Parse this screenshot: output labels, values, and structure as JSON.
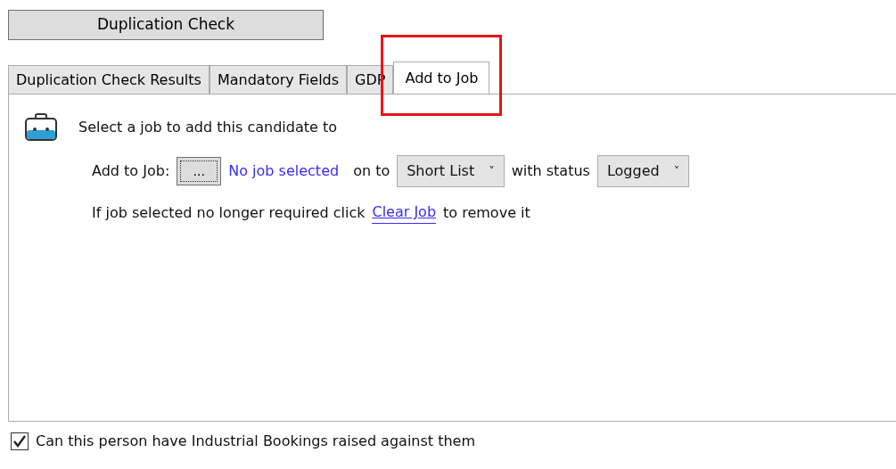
{
  "top_button": "Duplication Check",
  "tabs": [
    {
      "label": "Duplication Check Results",
      "selected": false
    },
    {
      "label": "Mandatory Fields",
      "selected": false
    },
    {
      "label": "GDP",
      "selected": false
    },
    {
      "label": "Add to Job",
      "selected": true,
      "highlighted": true
    }
  ],
  "panel": {
    "heading": "Select a job to add this candidate to",
    "add_label": "Add to Job:",
    "browse_button": "...",
    "job_link": "No job selected",
    "on_to": "on to",
    "list_select": {
      "value": "Short List",
      "caret": "˅"
    },
    "with_status": "with status",
    "status_select": {
      "value": "Logged",
      "caret": "˅"
    },
    "clear_before": "If job selected no longer required click",
    "clear_link": "Clear Job",
    "clear_after": "to remove it"
  },
  "checkbox": {
    "label": "Can this person have Industrial Bookings raised against them",
    "checked": true
  }
}
